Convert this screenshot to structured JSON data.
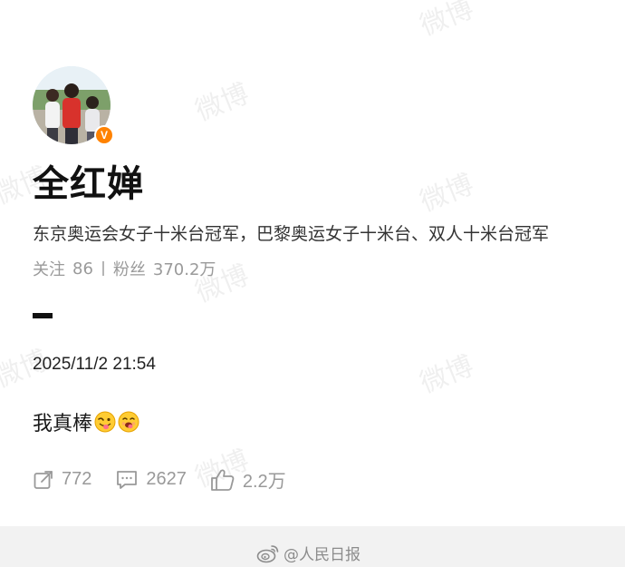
{
  "profile": {
    "name": "全红婵",
    "bio": "东京奥运会女子十米台冠军，巴黎奥运女子十米台、双人十米台冠军",
    "following_label": "关注",
    "following_count": "86",
    "followers_label": "粉丝",
    "followers_count": "370.2万",
    "verified_badge": "V"
  },
  "post": {
    "datetime": "2025/11/2 21:54",
    "text": "我真棒",
    "emojis": [
      "wink-tongue-emoji",
      "yum-emoji"
    ],
    "reposts": "772",
    "comments": "2627",
    "likes": "2.2万"
  },
  "watermark": {
    "text": "微博"
  },
  "footer": {
    "source": "@人民日报"
  },
  "colors": {
    "accent": "#ff8200",
    "muted": "#999999",
    "footer_bg": "#f2f2f2"
  }
}
